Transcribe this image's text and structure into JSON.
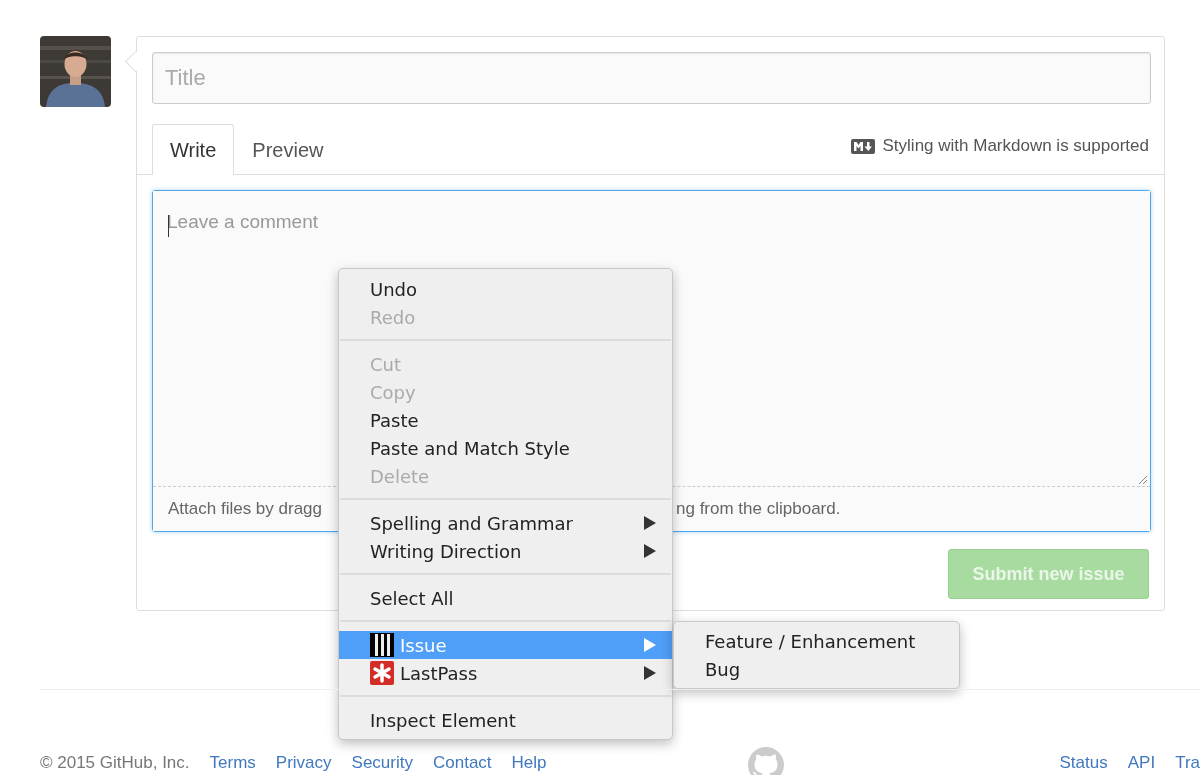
{
  "issue_form": {
    "title_field": {
      "placeholder": "Title"
    },
    "tabs": [
      {
        "label": "Write",
        "selected": true
      },
      {
        "label": "Preview",
        "selected": false
      }
    ],
    "markdown_note": "Styling with Markdown is supported",
    "comment_field": {
      "placeholder": "Leave a comment"
    },
    "attach_hint": [
      "Attach files by dragg",
      "ng from the clipboard."
    ],
    "submit_button": {
      "label": "Submit new issue",
      "disabled": true
    }
  },
  "context_menu": {
    "groups": [
      [
        {
          "label": "Undo",
          "disabled": false
        },
        {
          "label": "Redo",
          "disabled": true
        }
      ],
      [
        {
          "label": "Cut",
          "disabled": true
        },
        {
          "label": "Copy",
          "disabled": true
        },
        {
          "label": "Paste",
          "disabled": false
        },
        {
          "label": "Paste and Match Style",
          "disabled": false
        },
        {
          "label": "Delete",
          "disabled": true
        }
      ],
      [
        {
          "label": "Spelling and Grammar",
          "disabled": false,
          "submenu": true
        },
        {
          "label": "Writing Direction",
          "disabled": false,
          "submenu": true
        }
      ],
      [
        {
          "label": "Select All",
          "disabled": false
        }
      ],
      [
        {
          "label": "Issue",
          "disabled": false,
          "submenu": true,
          "selected": true,
          "kind": "bars"
        },
        {
          "label": "LastPass",
          "disabled": false,
          "submenu": true,
          "selected": false,
          "kind": "asterisk"
        }
      ],
      [
        {
          "label": "Inspect Element",
          "disabled": false
        }
      ]
    ],
    "submenu": [
      {
        "label": "Feature / Enhancement"
      },
      {
        "label": "Bug"
      }
    ]
  },
  "footer": {
    "copyright": "© 2015 GitHub, Inc.",
    "left_links": [
      "Terms",
      "Privacy",
      "Security",
      "Contact",
      "Help"
    ],
    "right_links": [
      "Status",
      "API",
      "Tra"
    ]
  }
}
